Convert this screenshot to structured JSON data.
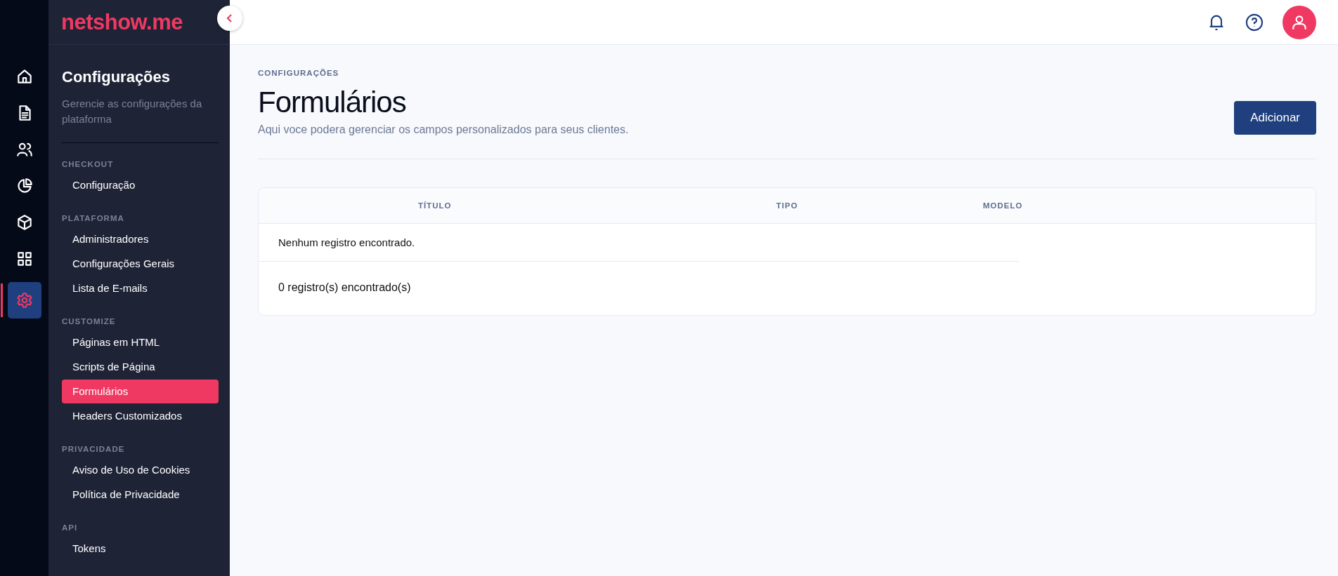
{
  "logo": {
    "text": "netshow.me"
  },
  "rail": [
    {
      "kind": "home",
      "selected": false
    },
    {
      "kind": "document",
      "selected": false
    },
    {
      "kind": "users",
      "selected": false
    },
    {
      "kind": "chart",
      "selected": false
    },
    {
      "kind": "box",
      "selected": false
    },
    {
      "kind": "grid",
      "selected": false
    },
    {
      "kind": "gear",
      "selected": true
    }
  ],
  "sidebar": {
    "title": "Configurações",
    "description": "Gerencie as configurações da plataforma",
    "sections": [
      {
        "heading": "CHECKOUT",
        "items": [
          {
            "label": "Configuração",
            "selected": false
          }
        ]
      },
      {
        "heading": "PLATAFORMA",
        "items": [
          {
            "label": "Administradores",
            "selected": false
          },
          {
            "label": "Configurações Gerais",
            "selected": false
          },
          {
            "label": "Lista de E-mails",
            "selected": false
          }
        ]
      },
      {
        "heading": "CUSTOMIZE",
        "items": [
          {
            "label": "Páginas em HTML",
            "selected": false
          },
          {
            "label": "Scripts de Página",
            "selected": false
          },
          {
            "label": "Formulários",
            "selected": true
          },
          {
            "label": "Headers Customizados",
            "selected": false
          }
        ]
      },
      {
        "heading": "PRIVACIDADE",
        "items": [
          {
            "label": "Aviso de Uso de Cookies",
            "selected": false
          },
          {
            "label": "Política de Privacidade",
            "selected": false
          }
        ]
      },
      {
        "heading": "API",
        "items": [
          {
            "label": "Tokens",
            "selected": false
          }
        ]
      }
    ]
  },
  "page": {
    "breadcrumb": "CONFIGURAÇÕES",
    "title": "Formulários",
    "subtitle": "Aqui voce podera gerenciar os campos personalizados para seus clientes.",
    "add_button": "Adicionar"
  },
  "table": {
    "columns": [
      "TÍTULO",
      "TIPO",
      "MODELO"
    ],
    "empty_message": "Nenhum registro encontrado.",
    "count": "0 registro(s) encontrado(s)"
  }
}
